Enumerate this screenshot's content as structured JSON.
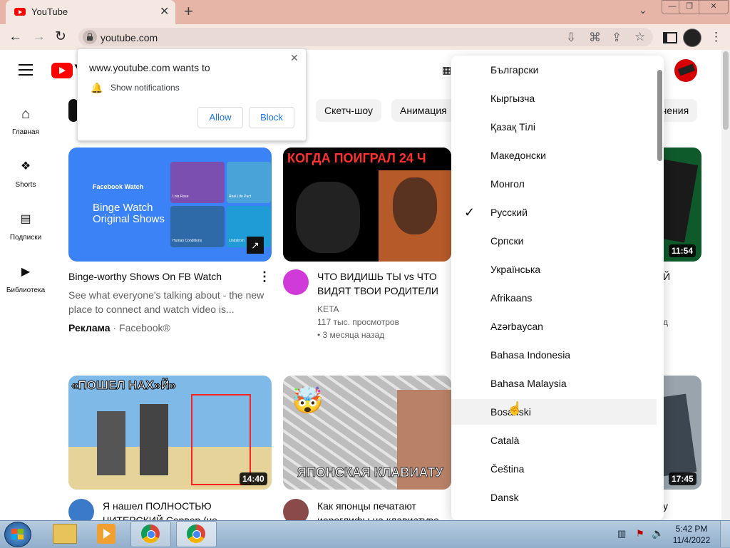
{
  "browser": {
    "tab_title": "YouTube",
    "url": "youtube.com",
    "tab_close": "✕",
    "new_tab": "+"
  },
  "youtube": {
    "logo_text": "Y",
    "sidebar": [
      {
        "label": "Главная",
        "icon": "home-icon"
      },
      {
        "label": "Shorts",
        "icon": "shorts-icon"
      },
      {
        "label": "Подписки",
        "icon": "subscriptions-icon"
      },
      {
        "label": "Библиотека",
        "icon": "library-icon"
      }
    ],
    "chips": [
      "Скетч-шоу",
      "Анимация",
      "чения"
    ],
    "videos": [
      {
        "title": "Binge-worthy Shows On FB Watch",
        "desc": "See what everyone's talking about - the new place to connect and watch video is...",
        "ad_label": "Реклама",
        "advertiser": "Facebook®",
        "thumb_line1": "Facebook Watch",
        "thumb_line2": "Binge Watch",
        "thumb_line3": "Original Shows",
        "names": [
          "Lola Rose",
          "Real Life Pact",
          "Human Conditions",
          "Lindstrom"
        ]
      },
      {
        "title_l1": "ЧТО ВИДИШЬ ТЫ vs ЧТО",
        "title_l2": "ВИДЯТ ТВОИ РОДИТЕЛИ",
        "channel": "KETA",
        "views": "117 тыс. просмотров",
        "age": "• 3 месяца назад",
        "thumb_text": "КОГДА ПОИГРАЛ 24 Ч"
      },
      {
        "duration": "11:54",
        "partial_title": "Й",
        "partial_meta": "д"
      },
      {
        "duration": "14:40",
        "title_l1": "Я нашел ПОЛНОСТЬЮ",
        "title_l2": "ЧИТЕРСКИЙ Сервер (че",
        "thumb_text": "«ПОШЕЛ НАХ»Й»"
      },
      {
        "title_l1": "Как японцы печатают",
        "title_l2": "иероглифы на клавиатуре",
        "thumb_text": "ЯПОНСКАЯ КЛАВИАТУ"
      },
      {
        "duration": "17:45",
        "partial_title": "у"
      }
    ]
  },
  "notification_popup": {
    "title": "www.youtube.com wants to",
    "permission": "Show notifications",
    "allow_label": "Allow",
    "block_label": "Block",
    "close": "✕"
  },
  "language_menu": {
    "items": [
      "Български",
      "Кыргызча",
      "Қазақ Тілі",
      "Македонски",
      "Монгол",
      "Русский",
      "Српски",
      "Українська",
      "Afrikaans",
      "Azərbaycan",
      "Bahasa Indonesia",
      "Bahasa Malaysia",
      "Bosanski",
      "Català",
      "Čeština",
      "Dansk"
    ],
    "selected": "Русский",
    "hovered": "Bosanski",
    "check": "✓"
  },
  "taskbar": {
    "time": "5:42 PM",
    "date": "11/4/2022"
  },
  "colors": {
    "youtube_red": "#ff0000",
    "chrome_frame": "#e7b5a8",
    "link_blue": "#1a73e8"
  }
}
